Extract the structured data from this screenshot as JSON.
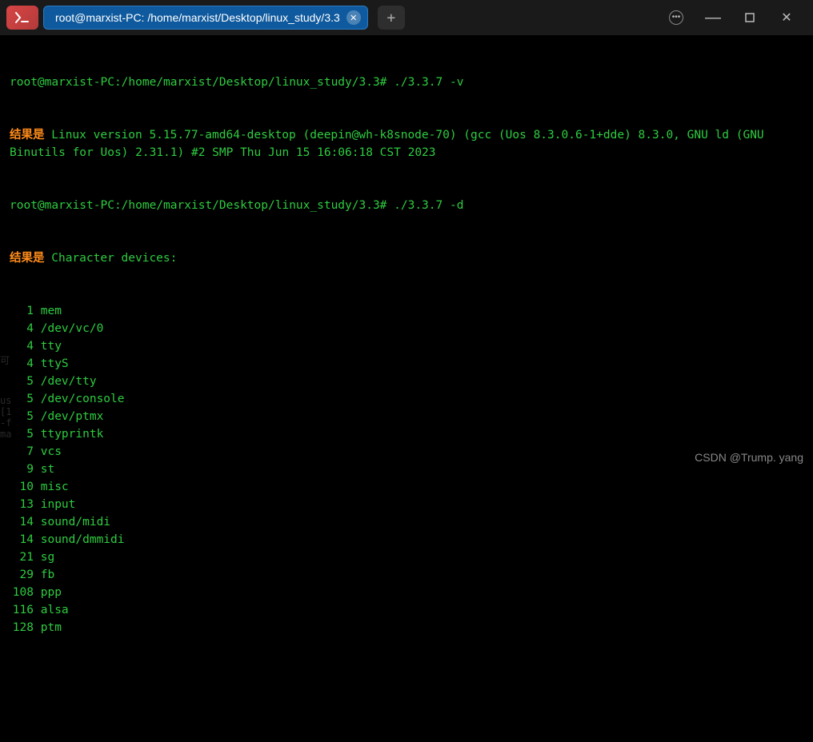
{
  "tab": {
    "title": "root@marxist-PC: /home/marxist/Desktop/linux_study/3.3"
  },
  "prompt1": {
    "full": "root@marxist-PC:/home/marxist/Desktop/linux_study/3.3#",
    "cmd": " ./3.3.7 -v"
  },
  "result1": {
    "label": "结果是",
    "text": " Linux version 5.15.77-amd64-desktop (deepin@wh-k8snode-70) (gcc (Uos 8.3.0.6-1+dde) 8.3.0, GNU ld (GNU\nBinutils for Uos) 2.31.1) #2 SMP Thu Jun 15 16:06:18 CST 2023"
  },
  "prompt2": {
    "full": "root@marxist-PC:/home/marxist/Desktop/linux_study/3.3#",
    "cmd": " ./3.3.7 -d"
  },
  "result2": {
    "label": "结果是",
    "text": " Character devices:"
  },
  "devices": [
    {
      "num": "1",
      "name": "mem"
    },
    {
      "num": "4",
      "name": "/dev/vc/0"
    },
    {
      "num": "4",
      "name": "tty"
    },
    {
      "num": "4",
      "name": "ttyS"
    },
    {
      "num": "5",
      "name": "/dev/tty"
    },
    {
      "num": "5",
      "name": "/dev/console"
    },
    {
      "num": "5",
      "name": "/dev/ptmx"
    },
    {
      "num": "5",
      "name": "ttyprintk"
    },
    {
      "num": "7",
      "name": "vcs"
    },
    {
      "num": "9",
      "name": "st"
    },
    {
      "num": "10",
      "name": "misc"
    },
    {
      "num": "13",
      "name": "input"
    },
    {
      "num": "14",
      "name": "sound/midi"
    },
    {
      "num": "14",
      "name": "sound/dmmidi"
    },
    {
      "num": "21",
      "name": "sg"
    },
    {
      "num": "29",
      "name": "fb"
    },
    {
      "num": "108",
      "name": "ppp"
    },
    {
      "num": "116",
      "name": "alsa"
    },
    {
      "num": "128",
      "name": "ptm"
    }
  ],
  "bg_fragments": [
    "可",
    "us",
    "[1",
    "-f",
    "ma"
  ],
  "watermark": "CSDN @Trump. yang"
}
